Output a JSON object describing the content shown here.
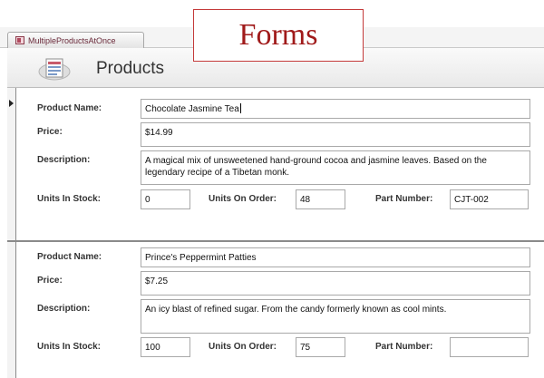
{
  "tab": {
    "label": "MultipleProductsAtOnce"
  },
  "banner": {
    "text": "Forms"
  },
  "header": {
    "title": "Products"
  },
  "labels": {
    "product_name": "Product Name:",
    "price": "Price:",
    "description": "Description:",
    "units_in_stock": "Units In Stock:",
    "units_on_order": "Units On Order:",
    "part_number": "Part Number:"
  },
  "records": [
    {
      "product_name": "Chocolate Jasmine Tea",
      "price": "$14.99",
      "description": "A magical mix of unsweetened hand-ground cocoa and jasmine leaves. Based on the legendary recipe of a Tibetan monk.",
      "units_in_stock": "0",
      "units_on_order": "48",
      "part_number": "CJT-002",
      "current": true
    },
    {
      "product_name": "Prince's Peppermint Patties",
      "price": "$7.25",
      "description": "An icy blast of refined sugar. From the candy formerly known as cool mints.",
      "units_in_stock": "100",
      "units_on_order": "75",
      "part_number": "",
      "current": false
    }
  ]
}
